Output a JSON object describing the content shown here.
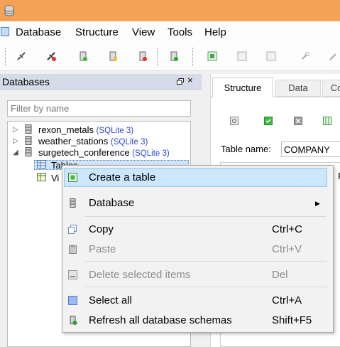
{
  "menubar": {
    "items": [
      "Database",
      "Structure",
      "View",
      "Tools",
      "Help"
    ]
  },
  "db_panel": {
    "title": "Databases",
    "float_icon": "float-window-icon",
    "close_glyph": "×",
    "filter_placeholder": "Filter by name",
    "databases": [
      {
        "name": "rexon_metals",
        "type": "(SQLite 3)",
        "expanded": false
      },
      {
        "name": "weather_stations",
        "type": "(SQLite 3)",
        "expanded": false
      },
      {
        "name": "surgetech_conference",
        "type": "(SQLite 3)",
        "expanded": true
      }
    ],
    "children": [
      "Tables",
      "Vi"
    ]
  },
  "right_panel": {
    "tabs": [
      "Structure",
      "Data",
      "Co"
    ],
    "active_tab": "Structure",
    "table_name_label": "Table name:",
    "table_name_value": "COMPANY",
    "side_letter": "F"
  },
  "context_menu": {
    "items": [
      {
        "label": "Create a table",
        "shortcut": "",
        "enabled": true,
        "icon": "create-table-icon",
        "highlighted": true
      },
      {
        "label": "Database",
        "shortcut": "",
        "enabled": true,
        "icon": "database-icon",
        "submenu": true
      },
      {
        "label": "Copy",
        "shortcut": "Ctrl+C",
        "enabled": true,
        "icon": "copy-icon"
      },
      {
        "label": "Paste",
        "shortcut": "Ctrl+V",
        "enabled": false,
        "icon": "paste-icon"
      },
      {
        "label": "Delete selected items",
        "shortcut": "Del",
        "enabled": false,
        "icon": "delete-icon"
      },
      {
        "label": "Select all",
        "shortcut": "Ctrl+A",
        "enabled": true,
        "icon": "select-all-icon"
      },
      {
        "label": "Refresh all database schemas",
        "shortcut": "Shift+F5",
        "enabled": true,
        "icon": "refresh-icon"
      }
    ]
  },
  "colors": {
    "titlebar": "#f3a256",
    "panel_header": "#d6dbe9",
    "sqlite_tag": "#2d48d8",
    "menu_highlight": "#cce6fb"
  }
}
